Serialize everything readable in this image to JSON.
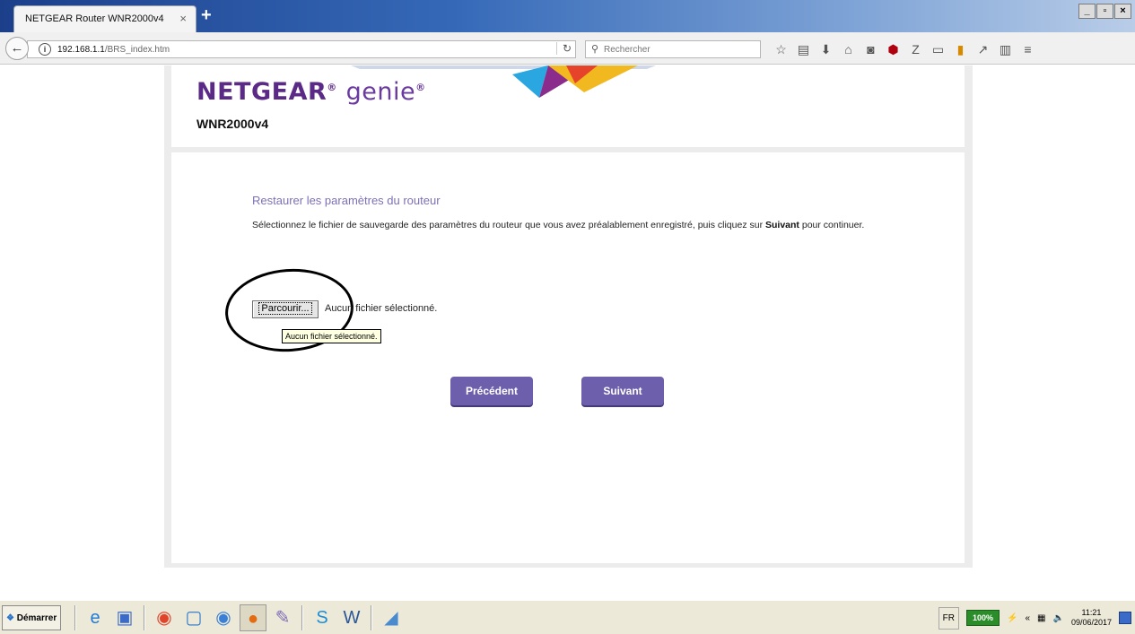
{
  "browser": {
    "tab_title": "NETGEAR Router WNR2000v4",
    "tab_close": "×",
    "new_tab": "+",
    "url_host": "192.168.1.1",
    "url_path": "/BRS_index.htm",
    "search_placeholder": "Rechercher",
    "window_controls": [
      "_",
      "▫",
      "×"
    ]
  },
  "header": {
    "brand": "NETGEAR",
    "product": "genie",
    "model": "WNR2000v4"
  },
  "main": {
    "title": "Restaurer les paramètres du routeur",
    "instructions_pre": "Sélectionnez le fichier de sauvegarde des paramètres du routeur que vous avez préalablement enregistré, puis cliquez sur ",
    "instructions_bold": "Suivant",
    "instructions_post": " pour continuer.",
    "browse_label": "Parcourir...",
    "file_status": "Aucun fichier sélectionné.",
    "tooltip": "Aucun fichier sélectionné.",
    "prev_label": "Précédent",
    "next_label": "Suivant"
  },
  "taskbar": {
    "start_label": "Démarrer",
    "language": "FR",
    "battery": "100%",
    "time": "11:21",
    "date": "09/06/2017"
  },
  "colors": {
    "accent_purple": "#6d5fab",
    "title_lilac": "#7e70b7",
    "brand_purple": "#5b2a86"
  }
}
